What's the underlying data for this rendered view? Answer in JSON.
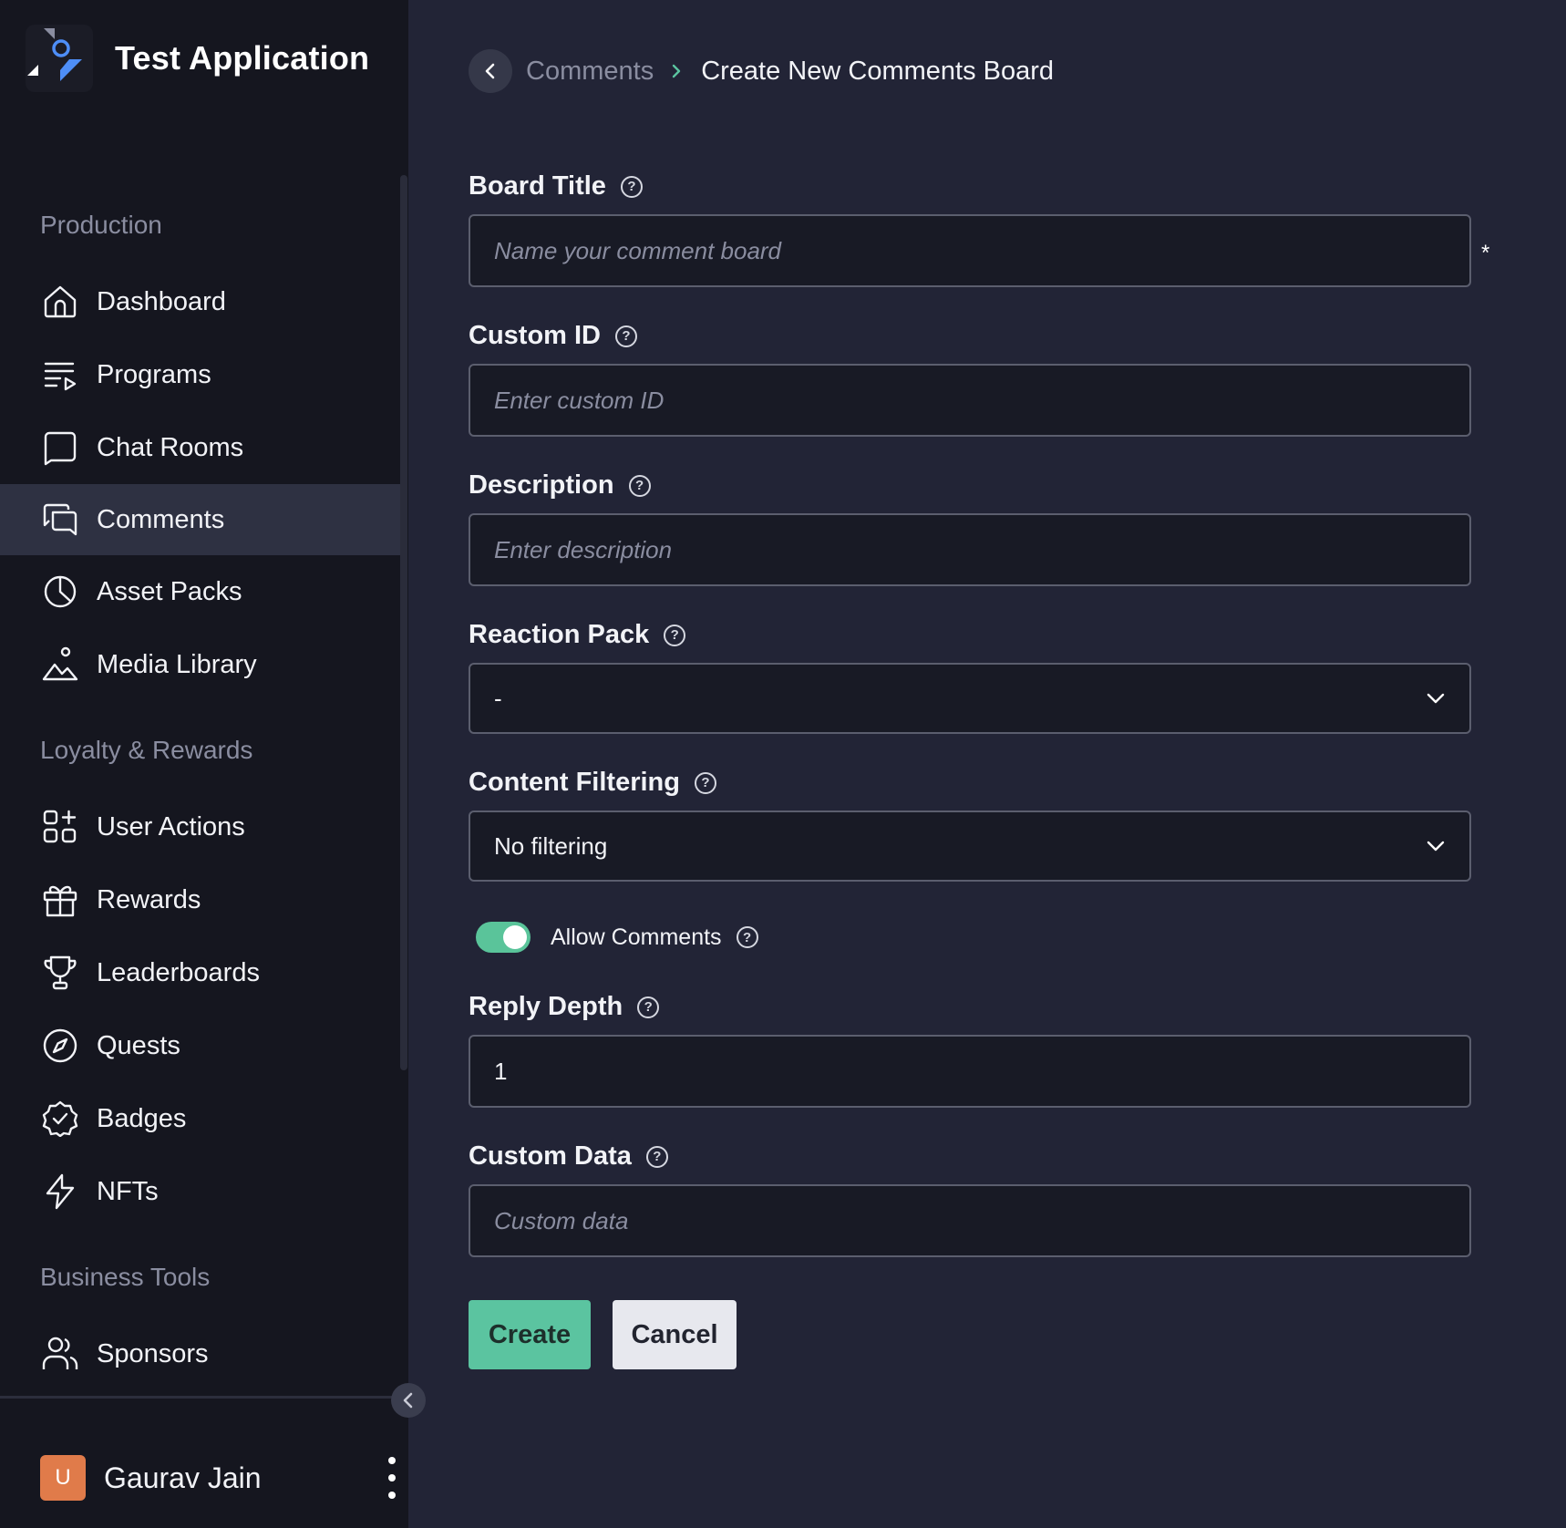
{
  "app": {
    "title": "Test Application"
  },
  "sidebar": {
    "sections": [
      {
        "label": "Production"
      },
      {
        "label": "Loyalty & Rewards"
      },
      {
        "label": "Business Tools"
      }
    ],
    "items": [
      {
        "label": "Dashboard",
        "icon": "home-icon"
      },
      {
        "label": "Programs",
        "icon": "playlist-icon"
      },
      {
        "label": "Chat Rooms",
        "icon": "chat-bubble-icon"
      },
      {
        "label": "Comments",
        "icon": "comments-icon",
        "active": true
      },
      {
        "label": "Asset Packs",
        "icon": "pie-chart-icon"
      },
      {
        "label": "Media Library",
        "icon": "image-icon"
      },
      {
        "label": "User Actions",
        "icon": "apps-add-icon"
      },
      {
        "label": "Rewards",
        "icon": "gift-icon"
      },
      {
        "label": "Leaderboards",
        "icon": "trophy-icon"
      },
      {
        "label": "Quests",
        "icon": "compass-icon"
      },
      {
        "label": "Badges",
        "icon": "badge-check-icon"
      },
      {
        "label": "NFTs",
        "icon": "lightning-icon"
      },
      {
        "label": "Sponsors",
        "icon": "users-icon"
      }
    ],
    "user": {
      "initial": "U",
      "name": "Gaurav Jain"
    }
  },
  "breadcrumb": {
    "parent": "Comments",
    "current": "Create New Comments Board"
  },
  "form": {
    "board_title": {
      "label": "Board Title",
      "placeholder": "Name your comment board",
      "value": "",
      "required_mark": "*"
    },
    "custom_id": {
      "label": "Custom ID",
      "placeholder": "Enter custom ID",
      "value": ""
    },
    "description": {
      "label": "Description",
      "placeholder": "Enter description",
      "value": ""
    },
    "reaction_pack": {
      "label": "Reaction Pack",
      "selected": "-"
    },
    "content_filtering": {
      "label": "Content Filtering",
      "selected": "No filtering"
    },
    "allow_comments": {
      "label": "Allow Comments",
      "on": true
    },
    "reply_depth": {
      "label": "Reply Depth",
      "value": "1"
    },
    "custom_data": {
      "label": "Custom Data",
      "placeholder": "Custom data",
      "value": ""
    },
    "help_glyph": "?"
  },
  "actions": {
    "create_label": "Create",
    "cancel_label": "Cancel"
  },
  "colors": {
    "background": "#222436",
    "sidebar": "#15161f",
    "active_item": "#2e3142",
    "accent_green": "#5bc4a0",
    "avatar": "#e07b4a"
  }
}
